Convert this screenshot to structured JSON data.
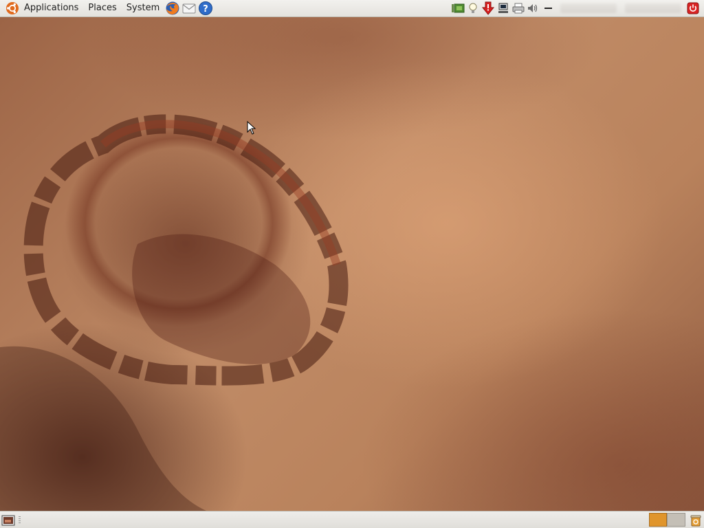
{
  "top_panel": {
    "menus": [
      "Applications",
      "Places",
      "System"
    ],
    "logo_icon": "ubuntu-logo-icon",
    "launchers": [
      "firefox-icon",
      "mail-icon",
      "help-icon"
    ],
    "tray_icons": [
      "network-manager-icon",
      "bulb-icon",
      "update-notifier-icon",
      "network-icon",
      "printer-icon",
      "volume-icon",
      "separator-dash-icon"
    ],
    "shutdown_icon": "power-icon"
  },
  "bottom_panel": {
    "show_desktop_icon": "show-desktop-icon",
    "workspaces": [
      "workspace-1",
      "workspace-2"
    ],
    "trash_icon": "trash-icon"
  },
  "colors": {
    "panel": "#ecebe8",
    "workspace_active": "#e0952c",
    "workspace_inactive": "#c4bfb6",
    "wallpaper_base": "#b07a55"
  }
}
